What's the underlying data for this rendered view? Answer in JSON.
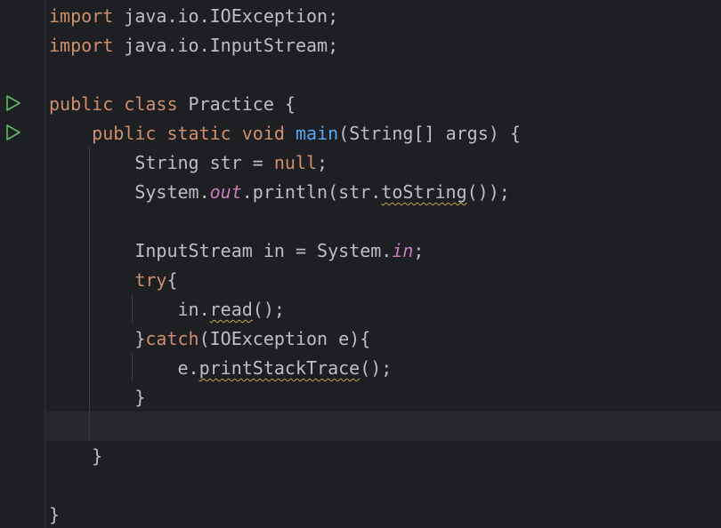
{
  "editor": {
    "language": "java",
    "colors": {
      "background": "#1e1f22",
      "keyword": "#cf8e6d",
      "method_declaration": "#56a8f5",
      "static_field": "#c77dbb",
      "text": "#bcbec4",
      "warning_squiggle": "#c9a54b",
      "run_icon": "#5fb865"
    },
    "gutter": {
      "run_icons": [
        "run-class-icon",
        "run-main-icon"
      ]
    },
    "lines": [
      {
        "kw1": "import",
        "t1": " java.io.IOException;"
      },
      {
        "kw1": "import",
        "t1": " java.io.InputStream;"
      },
      {},
      {
        "kw1": "public",
        "s1": " ",
        "kw2": "class",
        "t1": " Practice {"
      },
      {
        "indent": "    ",
        "kw1": "public",
        "s1": " ",
        "kw2": "static",
        "s2": " ",
        "kw3": "void",
        "s3": " ",
        "fn": "main",
        "t1": "(String[] args) {"
      },
      {
        "indent": "        ",
        "t1": "String str = ",
        "kw1": "null",
        "t2": ";"
      },
      {
        "indent": "        ",
        "t1": "System.",
        "field": "out",
        "t2": ".println(str.",
        "warn": "toString",
        "t3": "());"
      },
      {},
      {
        "indent": "        ",
        "t1": "InputStream in = System.",
        "field": "in",
        "t2": ";"
      },
      {
        "indent": "        ",
        "kw1": "try",
        "t1": "{"
      },
      {
        "indent": "            ",
        "t1": "in.",
        "warn": "read",
        "t2": "();"
      },
      {
        "indent": "        ",
        "t1": "}",
        "kw1": "catch",
        "t2": "(IOException e){"
      },
      {
        "indent": "            ",
        "t1": "e.",
        "warn": "printStackTrace",
        "t2": "();"
      },
      {
        "indent": "        ",
        "t1": "}"
      },
      {},
      {
        "indent": "    ",
        "t1": "}"
      },
      {},
      {
        "t1": "}"
      }
    ]
  }
}
